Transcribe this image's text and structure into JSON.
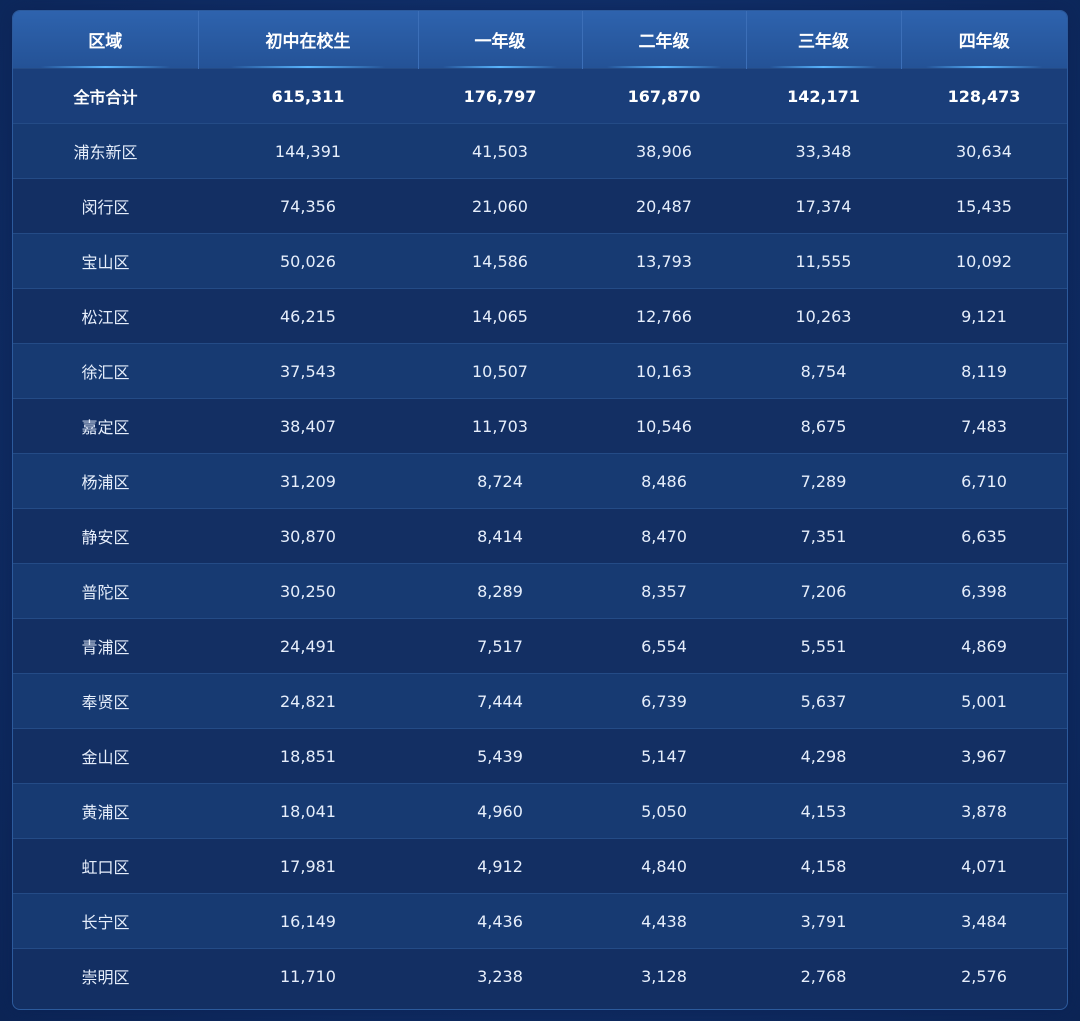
{
  "table": {
    "headers": [
      "区域",
      "初中在校生",
      "一年级",
      "二年级",
      "三年级",
      "四年级"
    ],
    "total_row": [
      "全市合计",
      "615,311",
      "176,797",
      "167,870",
      "142,171",
      "128,473"
    ],
    "rows": [
      [
        "浦东新区",
        "144,391",
        "41,503",
        "38,906",
        "33,348",
        "30,634"
      ],
      [
        "闵行区",
        "74,356",
        "21,060",
        "20,487",
        "17,374",
        "15,435"
      ],
      [
        "宝山区",
        "50,026",
        "14,586",
        "13,793",
        "11,555",
        "10,092"
      ],
      [
        "松江区",
        "46,215",
        "14,065",
        "12,766",
        "10,263",
        "9,121"
      ],
      [
        "徐汇区",
        "37,543",
        "10,507",
        "10,163",
        "8,754",
        "8,119"
      ],
      [
        "嘉定区",
        "38,407",
        "11,703",
        "10,546",
        "8,675",
        "7,483"
      ],
      [
        "杨浦区",
        "31,209",
        "8,724",
        "8,486",
        "7,289",
        "6,710"
      ],
      [
        "静安区",
        "30,870",
        "8,414",
        "8,470",
        "7,351",
        "6,635"
      ],
      [
        "普陀区",
        "30,250",
        "8,289",
        "8,357",
        "7,206",
        "6,398"
      ],
      [
        "青浦区",
        "24,491",
        "7,517",
        "6,554",
        "5,551",
        "4,869"
      ],
      [
        "奉贤区",
        "24,821",
        "7,444",
        "6,739",
        "5,637",
        "5,001"
      ],
      [
        "金山区",
        "18,851",
        "5,439",
        "5,147",
        "4,298",
        "3,967"
      ],
      [
        "黄浦区",
        "18,041",
        "4,960",
        "5,050",
        "4,153",
        "3,878"
      ],
      [
        "虹口区",
        "17,981",
        "4,912",
        "4,840",
        "4,158",
        "4,071"
      ],
      [
        "长宁区",
        "16,149",
        "4,436",
        "4,438",
        "3,791",
        "3,484"
      ],
      [
        "崇明区",
        "11,710",
        "3,238",
        "3,128",
        "2,768",
        "2,576"
      ]
    ]
  },
  "colors": {
    "background": "#11306a",
    "header_bg": "#2a5ba3",
    "total_row_bg": "#1a3e7a",
    "row_odd_bg": "#173a72",
    "row_even_bg": "#132f63",
    "text": "#e6eefb",
    "accent_glow": "#59b6ff"
  }
}
